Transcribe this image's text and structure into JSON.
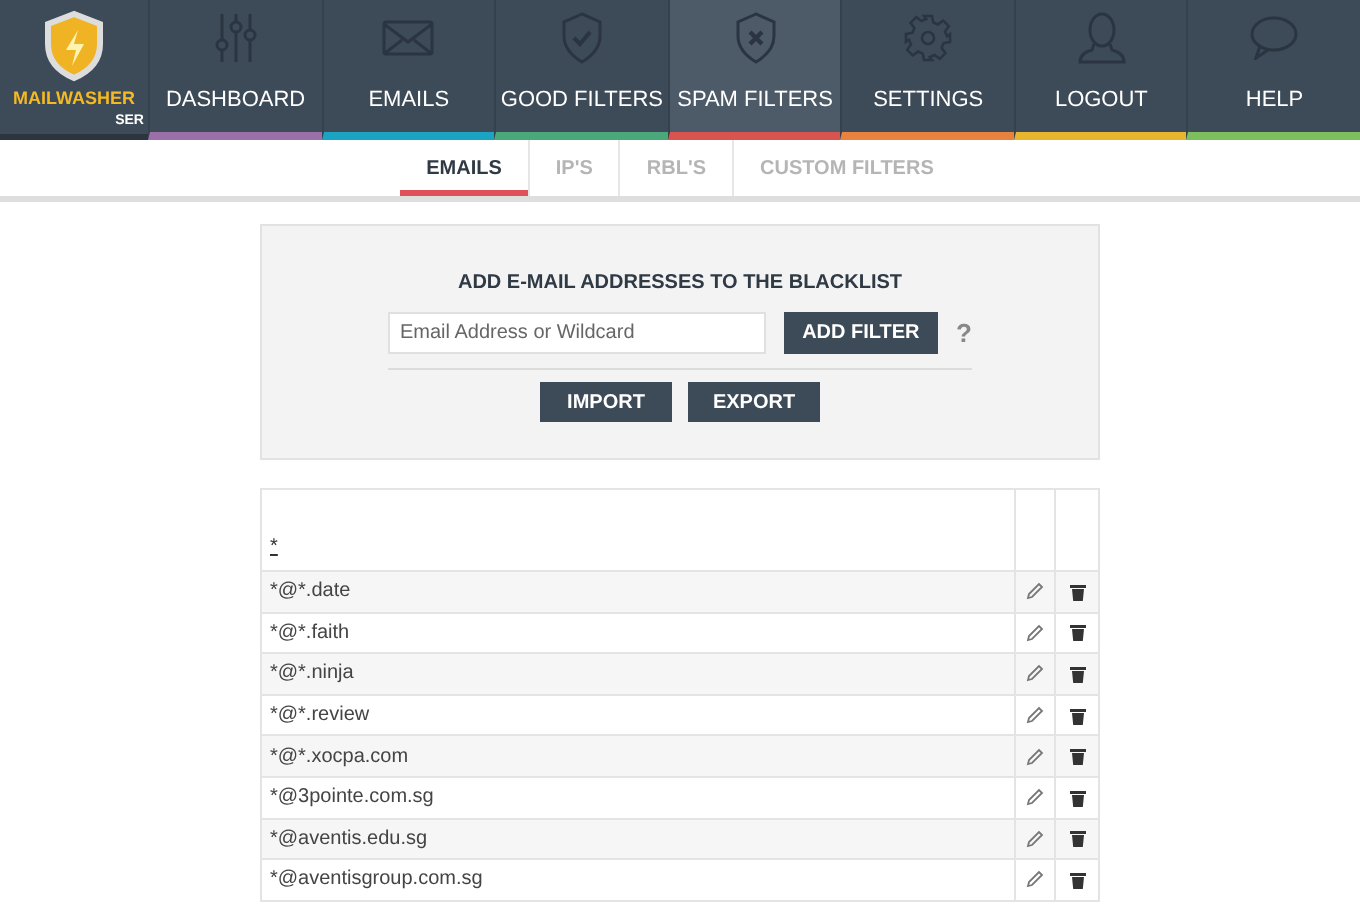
{
  "logo": {
    "name": "MAILWASHER",
    "suffix": "SER"
  },
  "nav": [
    {
      "label": "DASHBOARD",
      "color": "#9b6fa8",
      "selected": false
    },
    {
      "label": "EMAILS",
      "color": "#1ba3c2",
      "selected": false
    },
    {
      "label": "GOOD FILTERS",
      "color": "#4aa87a",
      "selected": false
    },
    {
      "label": "SPAM FILTERS",
      "color": "#d9534f",
      "selected": true
    },
    {
      "label": "SETTINGS",
      "color": "#e8823f",
      "selected": false
    },
    {
      "label": "LOGOUT",
      "color": "#e8b52f",
      "selected": false
    },
    {
      "label": "HELP",
      "color": "#7cbf5c",
      "selected": false
    }
  ],
  "subtabs": [
    {
      "label": "EMAILS",
      "selected": true
    },
    {
      "label": "IP'S",
      "selected": false
    },
    {
      "label": "RBL'S",
      "selected": false
    },
    {
      "label": "CUSTOM FILTERS",
      "selected": false
    }
  ],
  "add_panel": {
    "title": "ADD E-MAIL ADDRESSES TO THE BLACKLIST",
    "placeholder": "Email Address or Wildcard",
    "add_button": "ADD FILTER",
    "help": "?",
    "buttons": [
      "IMPORT",
      "EXPORT"
    ]
  },
  "table": {
    "header": "*",
    "rows": [
      "*@*.date",
      "*@*.faith",
      "*@*.ninja",
      "*@*.review",
      "*@*.xocpa.com",
      "*@3pointe.com.sg",
      "*@aventis.edu.sg",
      "*@aventisgroup.com.sg"
    ]
  }
}
